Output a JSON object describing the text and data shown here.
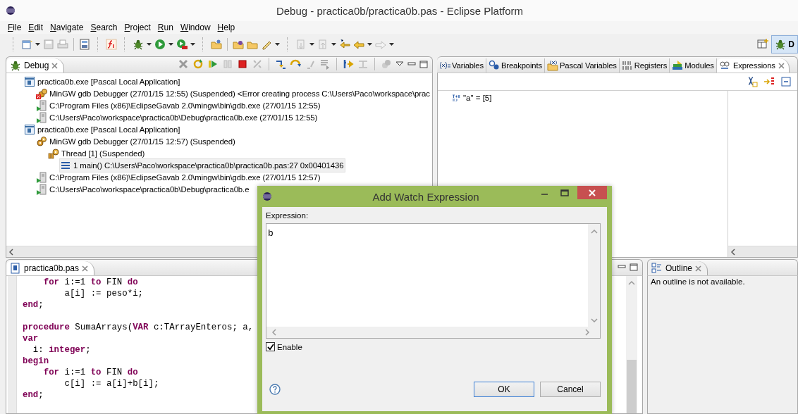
{
  "window": {
    "title": "Debug - practica0b/practica0b.pas - Eclipse Platform"
  },
  "menu": [
    "File",
    "Edit",
    "Navigate",
    "Search",
    "Project",
    "Run",
    "Window",
    "Help"
  ],
  "perspectives": [
    {
      "label": "D",
      "selected": true
    }
  ],
  "debug_view": {
    "tab": "Debug",
    "tree": [
      {
        "kind": "launch",
        "label": "practica0b.exe [Pascal Local Application]",
        "selected": false,
        "children": [
          {
            "kind": "debugger_error",
            "label": "MinGW gdb Debugger (27/01/15 12:55) (Suspended) <Error creating process C:\\Users\\Paco\\workspace\\prac",
            "selected": false
          },
          {
            "kind": "process",
            "label": "C:\\Program Files (x86)\\EclipseGavab 2.0\\mingw\\bin\\gdb.exe (27/01/15 12:55)",
            "selected": false
          },
          {
            "kind": "process",
            "label": "C:\\Users\\Paco\\workspace\\practica0b\\Debug\\practica0b.exe (27/01/15 12:55)",
            "selected": false
          }
        ]
      },
      {
        "kind": "launch",
        "label": "practica0b.exe [Pascal Local Application]",
        "selected": false,
        "children": [
          {
            "kind": "debugger",
            "label": "MinGW gdb Debugger (27/01/15 12:57) (Suspended)",
            "selected": false,
            "children": [
              {
                "kind": "thread",
                "label": "Thread [1] (Suspended)",
                "selected": false,
                "children": [
                  {
                    "kind": "frame",
                    "label": "1 main() C:\\Users\\Paco\\workspace\\practica0b\\practica0b.pas:27 0x00401436",
                    "selected": true
                  }
                ]
              }
            ]
          },
          {
            "kind": "process",
            "label": "C:\\Program Files (x86)\\EclipseGavab 2.0\\mingw\\bin\\gdb.exe (27/01/15 12:57)",
            "selected": false
          },
          {
            "kind": "process",
            "label": "C:\\Users\\Paco\\workspace\\practica0b\\Debug\\practica0b.e",
            "selected": false
          }
        ]
      }
    ]
  },
  "expressions_view": {
    "tabs": [
      {
        "kind": "variables",
        "label": "Variables",
        "selected": false
      },
      {
        "kind": "breakpoints",
        "label": "Breakpoints",
        "selected": false
      },
      {
        "kind": "pascal_variables",
        "label": "Pascal Variables",
        "selected": false
      },
      {
        "kind": "registers",
        "label": "Registers",
        "selected": false
      },
      {
        "kind": "modules",
        "label": "Modules",
        "selected": false
      },
      {
        "kind": "expressions",
        "label": "Expressions",
        "selected": true
      }
    ],
    "expressions": [
      "\"a\" = [5]"
    ]
  },
  "editor": {
    "tab": "practica0b.pas",
    "lines": [
      {
        "segments": [
          {
            "text": "    for",
            "kind": "keyword"
          },
          {
            "text": " i:=1 ",
            "kind": "plain"
          },
          {
            "text": "to",
            "kind": "keyword"
          },
          {
            "text": " FIN ",
            "kind": "plain"
          },
          {
            "text": "do",
            "kind": "keyword"
          }
        ]
      },
      {
        "segments": [
          {
            "text": "        a[i] := peso*i;",
            "kind": "plain"
          }
        ]
      },
      {
        "segments": [
          {
            "text": "end",
            "kind": "keyword"
          },
          {
            "text": ";",
            "kind": "plain"
          }
        ],
        "blank_line_after": true
      },
      {
        "segments": [
          {
            "text": "procedure",
            "kind": "keyword"
          },
          {
            "text": " SumaArrays(",
            "kind": "plain"
          },
          {
            "text": "VAR",
            "kind": "keyword"
          },
          {
            "text": " c:TArrayEnteros; a,",
            "kind": "plain"
          }
        ]
      },
      {
        "segments": [
          {
            "text": "var",
            "kind": "keyword"
          }
        ]
      },
      {
        "segments": [
          {
            "text": "  i: ",
            "kind": "plain"
          },
          {
            "text": "integer",
            "kind": "keyword"
          },
          {
            "text": ";",
            "kind": "plain"
          }
        ]
      },
      {
        "segments": [
          {
            "text": "begin",
            "kind": "keyword"
          }
        ]
      },
      {
        "segments": [
          {
            "text": "    for",
            "kind": "keyword"
          },
          {
            "text": " i:=1 ",
            "kind": "plain"
          },
          {
            "text": "to",
            "kind": "keyword"
          },
          {
            "text": " FIN ",
            "kind": "plain"
          },
          {
            "text": "do",
            "kind": "keyword"
          }
        ]
      },
      {
        "segments": [
          {
            "text": "        c[i] := a[i]+b[i];",
            "kind": "plain"
          }
        ]
      },
      {
        "segments": [
          {
            "text": "end",
            "kind": "keyword"
          },
          {
            "text": ";",
            "kind": "plain"
          }
        ]
      }
    ]
  },
  "outline_view": {
    "tab": "Outline",
    "message": "An outline is not available."
  },
  "dialog": {
    "title": "Add Watch Expression",
    "label": "Expression:",
    "expression": "b",
    "enable": {
      "label": "Enable",
      "checked": true
    },
    "buttons": [
      {
        "label": "OK",
        "default": true
      },
      {
        "label": "Cancel",
        "default": false
      }
    ]
  }
}
